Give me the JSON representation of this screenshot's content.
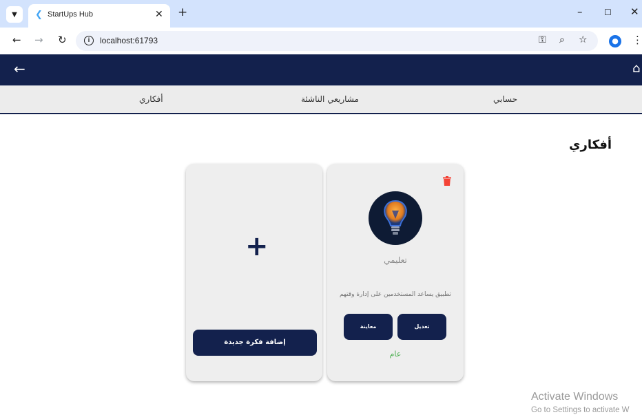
{
  "browser": {
    "tab_title": "StartUps Hub",
    "url": "localhost:61793",
    "icons": [
      "tab-list-icon",
      "close-icon",
      "new-tab-icon",
      "minimize-icon",
      "maximize-icon",
      "back-icon",
      "forward-icon",
      "reload-icon",
      "info-icon",
      "key-icon",
      "zoom-icon",
      "star-icon",
      "profile-icon",
      "menu-icon"
    ]
  },
  "appbar": {
    "icons": [
      "back-arrow-icon",
      "home-icon"
    ],
    "color": "#13214d"
  },
  "nav_tabs": [
    "أفكاري",
    "مشاريعي الناشئة",
    "حسابي"
  ],
  "page": {
    "title": "أفكاري"
  },
  "add_card": {
    "plus": "+",
    "button_label": "إضافة فكرة جديدة"
  },
  "idea_card": {
    "name": "تعليمي",
    "description": "تطبيق يساعد المستخدمين على إدارة وقتهم",
    "edit_label": "تعديل",
    "preview_label": "معاينة",
    "visibility": "عام",
    "visibility_color": "#4caf50",
    "delete_color": "#f44336"
  },
  "watermark": {
    "title": "Activate Windows",
    "subtitle": "Go to Settings to activate W"
  }
}
